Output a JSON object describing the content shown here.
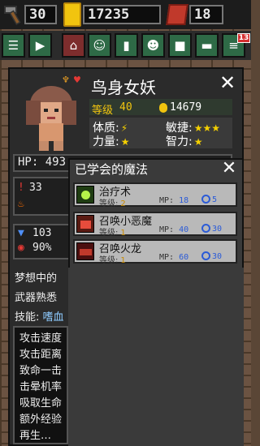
{
  "top_bar": {
    "hammer_count": "30",
    "gold_total": "17235",
    "gem_count": "18"
  },
  "toolbar": {
    "notification_badge": "13"
  },
  "character": {
    "name": "鸟身女妖",
    "level_label": "等级",
    "level": "40",
    "gold": "14679",
    "attributes": [
      {
        "label": "体质:",
        "value": "⚡"
      },
      {
        "label": "敏捷:",
        "value": "★★★"
      },
      {
        "label": "力量:",
        "value": "★"
      },
      {
        "label": "智力:",
        "value": "★"
      }
    ],
    "hp_label": "HP: 493",
    "stat_1": "33 ",
    "stat_2": "103",
    "stat_3": "90%",
    "desc_line_1": "梦想中的",
    "desc_line_2": "武器熟悉",
    "skills_label": "技能:",
    "skills_value": "嗜血",
    "detail_items": [
      "攻击速度",
      "攻击距离",
      "致命一击",
      "击晕机率",
      "吸取生命",
      "额外经验",
      "再生…"
    ]
  },
  "magic_popup": {
    "title": "已学会的魔法",
    "spells": [
      {
        "name": "治疗术",
        "level_label": "等级:",
        "level": "2",
        "mp_label": "MP:",
        "mp": "18",
        "cooldown": "5",
        "icon": "heal-icon",
        "icon_color": "#7ad33a"
      },
      {
        "name": "召唤小恶魔",
        "level_label": "等级:",
        "level": "1",
        "mp_label": "MP:",
        "mp": "40",
        "cooldown": "30",
        "icon": "imp-icon",
        "icon_color": "#c0392b"
      },
      {
        "name": "召唤火龙",
        "level_label": "等级:",
        "level": "1",
        "mp_label": "MP:",
        "mp": "60",
        "cooldown": "30",
        "icon": "dragon-icon",
        "icon_color": "#a01b1b"
      }
    ]
  },
  "colors": {
    "accent_gold": "#f1c40f",
    "panel": "#2b2b2b",
    "spell_row": "#b9b9b9",
    "mp_blue": "#2b5bd7"
  }
}
